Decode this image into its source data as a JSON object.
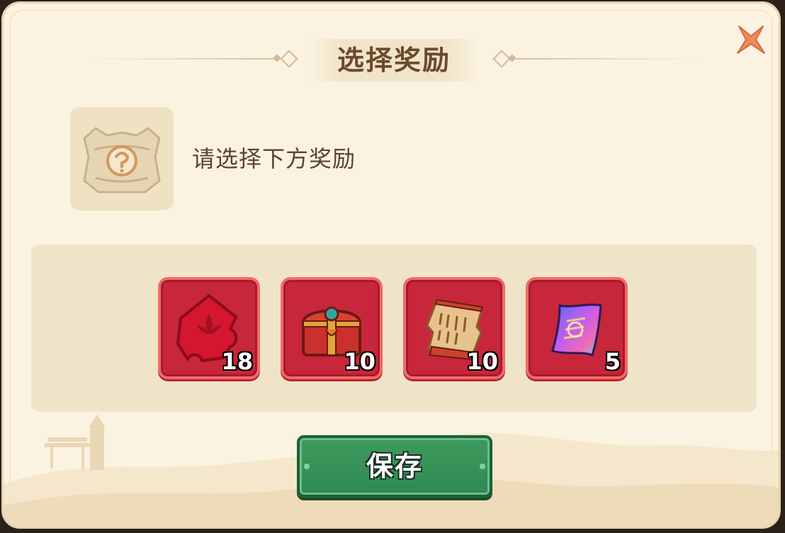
{
  "dialog": {
    "title": "选择奖励",
    "close_icon": "close-x-icon"
  },
  "info": {
    "icon": "mystery-chest-icon",
    "text": "请选择下方奖励"
  },
  "rewards": [
    {
      "icon": "red-lotus-puzzle-piece-icon",
      "count": "18"
    },
    {
      "icon": "red-treasure-chest-icon",
      "count": "10"
    },
    {
      "icon": "torn-scroll-icon",
      "count": "10"
    },
    {
      "icon": "holographic-ticket-icon",
      "count": "5"
    }
  ],
  "save_button": {
    "label": "保存"
  },
  "colors": {
    "panel_bg": "#fbf3e1",
    "reward_bg": "#c8263a",
    "reward_border": "#f26a63",
    "save_green": "#3f9a5f",
    "title_brown": "#6b4a2b"
  }
}
